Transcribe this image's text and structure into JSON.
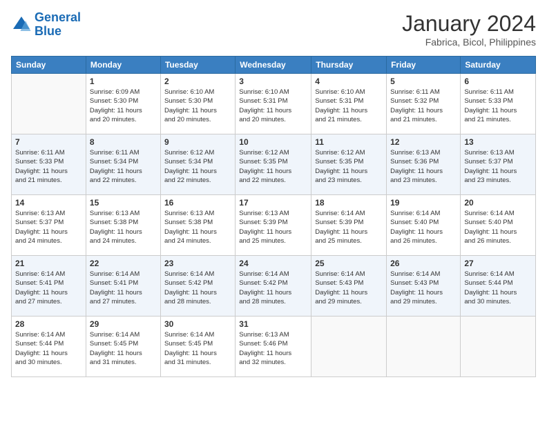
{
  "logo": {
    "line1": "General",
    "line2": "Blue"
  },
  "title": "January 2024",
  "subtitle": "Fabrica, Bicol, Philippines",
  "days_of_week": [
    "Sunday",
    "Monday",
    "Tuesday",
    "Wednesday",
    "Thursday",
    "Friday",
    "Saturday"
  ],
  "weeks": [
    [
      {
        "day": "",
        "sunrise": "",
        "sunset": "",
        "daylight": ""
      },
      {
        "day": "1",
        "sunrise": "Sunrise: 6:09 AM",
        "sunset": "Sunset: 5:30 PM",
        "daylight": "Daylight: 11 hours and 20 minutes."
      },
      {
        "day": "2",
        "sunrise": "Sunrise: 6:10 AM",
        "sunset": "Sunset: 5:30 PM",
        "daylight": "Daylight: 11 hours and 20 minutes."
      },
      {
        "day": "3",
        "sunrise": "Sunrise: 6:10 AM",
        "sunset": "Sunset: 5:31 PM",
        "daylight": "Daylight: 11 hours and 20 minutes."
      },
      {
        "day": "4",
        "sunrise": "Sunrise: 6:10 AM",
        "sunset": "Sunset: 5:31 PM",
        "daylight": "Daylight: 11 hours and 21 minutes."
      },
      {
        "day": "5",
        "sunrise": "Sunrise: 6:11 AM",
        "sunset": "Sunset: 5:32 PM",
        "daylight": "Daylight: 11 hours and 21 minutes."
      },
      {
        "day": "6",
        "sunrise": "Sunrise: 6:11 AM",
        "sunset": "Sunset: 5:33 PM",
        "daylight": "Daylight: 11 hours and 21 minutes."
      }
    ],
    [
      {
        "day": "7",
        "sunrise": "Sunrise: 6:11 AM",
        "sunset": "Sunset: 5:33 PM",
        "daylight": "Daylight: 11 hours and 21 minutes."
      },
      {
        "day": "8",
        "sunrise": "Sunrise: 6:11 AM",
        "sunset": "Sunset: 5:34 PM",
        "daylight": "Daylight: 11 hours and 22 minutes."
      },
      {
        "day": "9",
        "sunrise": "Sunrise: 6:12 AM",
        "sunset": "Sunset: 5:34 PM",
        "daylight": "Daylight: 11 hours and 22 minutes."
      },
      {
        "day": "10",
        "sunrise": "Sunrise: 6:12 AM",
        "sunset": "Sunset: 5:35 PM",
        "daylight": "Daylight: 11 hours and 22 minutes."
      },
      {
        "day": "11",
        "sunrise": "Sunrise: 6:12 AM",
        "sunset": "Sunset: 5:35 PM",
        "daylight": "Daylight: 11 hours and 23 minutes."
      },
      {
        "day": "12",
        "sunrise": "Sunrise: 6:13 AM",
        "sunset": "Sunset: 5:36 PM",
        "daylight": "Daylight: 11 hours and 23 minutes."
      },
      {
        "day": "13",
        "sunrise": "Sunrise: 6:13 AM",
        "sunset": "Sunset: 5:37 PM",
        "daylight": "Daylight: 11 hours and 23 minutes."
      }
    ],
    [
      {
        "day": "14",
        "sunrise": "Sunrise: 6:13 AM",
        "sunset": "Sunset: 5:37 PM",
        "daylight": "Daylight: 11 hours and 24 minutes."
      },
      {
        "day": "15",
        "sunrise": "Sunrise: 6:13 AM",
        "sunset": "Sunset: 5:38 PM",
        "daylight": "Daylight: 11 hours and 24 minutes."
      },
      {
        "day": "16",
        "sunrise": "Sunrise: 6:13 AM",
        "sunset": "Sunset: 5:38 PM",
        "daylight": "Daylight: 11 hours and 24 minutes."
      },
      {
        "day": "17",
        "sunrise": "Sunrise: 6:13 AM",
        "sunset": "Sunset: 5:39 PM",
        "daylight": "Daylight: 11 hours and 25 minutes."
      },
      {
        "day": "18",
        "sunrise": "Sunrise: 6:14 AM",
        "sunset": "Sunset: 5:39 PM",
        "daylight": "Daylight: 11 hours and 25 minutes."
      },
      {
        "day": "19",
        "sunrise": "Sunrise: 6:14 AM",
        "sunset": "Sunset: 5:40 PM",
        "daylight": "Daylight: 11 hours and 26 minutes."
      },
      {
        "day": "20",
        "sunrise": "Sunrise: 6:14 AM",
        "sunset": "Sunset: 5:40 PM",
        "daylight": "Daylight: 11 hours and 26 minutes."
      }
    ],
    [
      {
        "day": "21",
        "sunrise": "Sunrise: 6:14 AM",
        "sunset": "Sunset: 5:41 PM",
        "daylight": "Daylight: 11 hours and 27 minutes."
      },
      {
        "day": "22",
        "sunrise": "Sunrise: 6:14 AM",
        "sunset": "Sunset: 5:41 PM",
        "daylight": "Daylight: 11 hours and 27 minutes."
      },
      {
        "day": "23",
        "sunrise": "Sunrise: 6:14 AM",
        "sunset": "Sunset: 5:42 PM",
        "daylight": "Daylight: 11 hours and 28 minutes."
      },
      {
        "day": "24",
        "sunrise": "Sunrise: 6:14 AM",
        "sunset": "Sunset: 5:42 PM",
        "daylight": "Daylight: 11 hours and 28 minutes."
      },
      {
        "day": "25",
        "sunrise": "Sunrise: 6:14 AM",
        "sunset": "Sunset: 5:43 PM",
        "daylight": "Daylight: 11 hours and 29 minutes."
      },
      {
        "day": "26",
        "sunrise": "Sunrise: 6:14 AM",
        "sunset": "Sunset: 5:43 PM",
        "daylight": "Daylight: 11 hours and 29 minutes."
      },
      {
        "day": "27",
        "sunrise": "Sunrise: 6:14 AM",
        "sunset": "Sunset: 5:44 PM",
        "daylight": "Daylight: 11 hours and 30 minutes."
      }
    ],
    [
      {
        "day": "28",
        "sunrise": "Sunrise: 6:14 AM",
        "sunset": "Sunset: 5:44 PM",
        "daylight": "Daylight: 11 hours and 30 minutes."
      },
      {
        "day": "29",
        "sunrise": "Sunrise: 6:14 AM",
        "sunset": "Sunset: 5:45 PM",
        "daylight": "Daylight: 11 hours and 31 minutes."
      },
      {
        "day": "30",
        "sunrise": "Sunrise: 6:14 AM",
        "sunset": "Sunset: 5:45 PM",
        "daylight": "Daylight: 11 hours and 31 minutes."
      },
      {
        "day": "31",
        "sunrise": "Sunrise: 6:13 AM",
        "sunset": "Sunset: 5:46 PM",
        "daylight": "Daylight: 11 hours and 32 minutes."
      },
      {
        "day": "",
        "sunrise": "",
        "sunset": "",
        "daylight": ""
      },
      {
        "day": "",
        "sunrise": "",
        "sunset": "",
        "daylight": ""
      },
      {
        "day": "",
        "sunrise": "",
        "sunset": "",
        "daylight": ""
      }
    ]
  ]
}
